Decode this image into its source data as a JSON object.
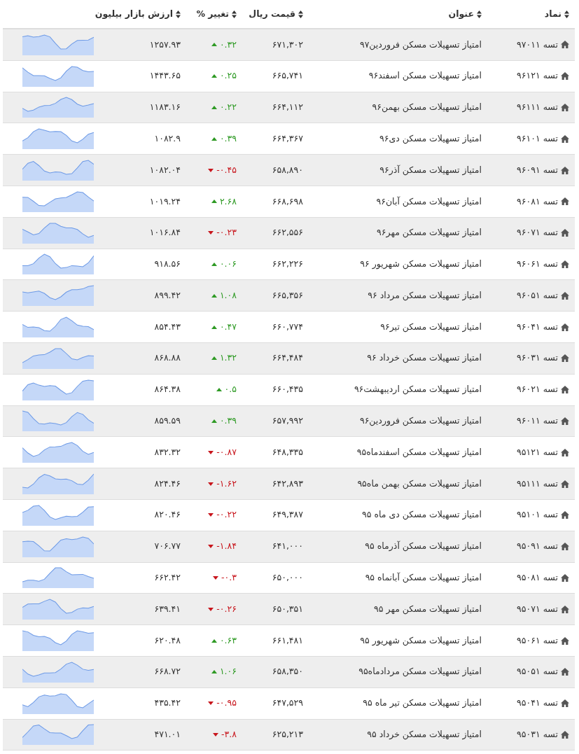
{
  "table": {
    "columns": [
      "نماد",
      "عنوان",
      "قیمت ریال",
      "تغییر %",
      "ارزش بازار بیلیون"
    ],
    "rows": [
      {
        "symbol": "تسه ۹۷۰۱۱",
        "title": "امتیاز تسهیلات مسکن فروردین۹۷",
        "price": "۶۷۱,۳۰۲",
        "change": "۰.۳۲",
        "kind": "up",
        "market_value": "۱۲۵۷.۹۳"
      },
      {
        "symbol": "تسه ۹۶۱۲۱",
        "title": "امتیاز تسهیلات مسکن اسفند۹۶",
        "price": "۶۶۵,۷۴۱",
        "change": "۰.۲۵",
        "kind": "up",
        "market_value": "۱۴۴۳.۶۵"
      },
      {
        "symbol": "تسه ۹۶۱۱۱",
        "title": "امتیاز تسهیلات مسکن بهمن۹۶",
        "price": "۶۶۴,۱۱۲",
        "change": "۰.۲۲",
        "kind": "up",
        "market_value": "۱۱۸۳.۱۶"
      },
      {
        "symbol": "تسه ۹۶۱۰۱",
        "title": "امتیاز تسهیلات مسکن دی۹۶",
        "price": "۶۶۴,۳۶۷",
        "change": "۰.۳۹",
        "kind": "up",
        "market_value": "۱۰۸۲.۹"
      },
      {
        "symbol": "تسه ۹۶۰۹۱",
        "title": "امتیاز تسهیلات مسکن آذر۹۶",
        "price": "۶۵۸,۸۹۰",
        "change": "-۰.۴۵",
        "kind": "down",
        "market_value": "۱۰۸۲.۰۴"
      },
      {
        "symbol": "تسه ۹۶۰۸۱",
        "title": "امتیاز تسهیلات مسکن آبان۹۶",
        "price": "۶۶۸,۶۹۸",
        "change": "۲.۶۸",
        "kind": "up",
        "market_value": "۱۰۱۹.۲۴"
      },
      {
        "symbol": "تسه ۹۶۰۷۱",
        "title": "امتیاز تسهیلات مسکن مهر۹۶",
        "price": "۶۶۲,۵۵۶",
        "change": "-۰.۲۳",
        "kind": "down",
        "market_value": "۱۰۱۶.۸۴"
      },
      {
        "symbol": "تسه ۹۶۰۶۱",
        "title": "امتیاز تسهیلات مسکن شهریور ۹۶",
        "price": "۶۶۲,۲۲۶",
        "change": "۰.۰۶",
        "kind": "up",
        "market_value": "۹۱۸.۵۶"
      },
      {
        "symbol": "تسه ۹۶۰۵۱",
        "title": "امتیاز تسهیلات مسکن مرداد ۹۶",
        "price": "۶۶۵,۳۵۶",
        "change": "۱.۰۸",
        "kind": "up",
        "market_value": "۸۹۹.۴۲"
      },
      {
        "symbol": "تسه ۹۶۰۴۱",
        "title": "امتیاز تسهیلات مسکن تیر۹۶",
        "price": "۶۶۰,۷۷۴",
        "change": "۰.۴۷",
        "kind": "up",
        "market_value": "۸۵۴.۴۳"
      },
      {
        "symbol": "تسه ۹۶۰۳۱",
        "title": "امتیاز تسهیلات مسکن خرداد ۹۶",
        "price": "۶۶۴,۴۸۴",
        "change": "۱.۳۲",
        "kind": "up",
        "market_value": "۸۶۸.۸۸"
      },
      {
        "symbol": "تسه ۹۶۰۲۱",
        "title": "امتیاز تسهیلات مسکن اردیبهشت۹۶",
        "price": "۶۶۰,۴۳۵",
        "change": "۰.۵",
        "kind": "up",
        "market_value": "۸۶۴.۳۸"
      },
      {
        "symbol": "تسه ۹۶۰۱۱",
        "title": "امتیاز تسهیلات مسکن فروردین۹۶",
        "price": "۶۵۷,۹۹۲",
        "change": "۰.۳۹",
        "kind": "up",
        "market_value": "۸۵۹.۵۹"
      },
      {
        "symbol": "تسه ۹۵۱۲۱",
        "title": "امتیاز تسهیلات مسکن اسفندماه۹۵",
        "price": "۶۴۸,۳۳۵",
        "change": "-۰.۸۷",
        "kind": "down",
        "market_value": "۸۳۲.۳۲"
      },
      {
        "symbol": "تسه ۹۵۱۱۱",
        "title": "امتیاز تسهیلات مسکن بهمن ماه۹۵",
        "price": "۶۴۲,۸۹۳",
        "change": "-۱.۶۲",
        "kind": "down",
        "market_value": "۸۲۴.۴۶"
      },
      {
        "symbol": "تسه ۹۵۱۰۱",
        "title": "امتیاز تسهیلات مسکن دی ماه ۹۵",
        "price": "۶۴۹,۳۸۷",
        "change": "-۰.۲۲",
        "kind": "down",
        "market_value": "۸۲۰.۴۶"
      },
      {
        "symbol": "تسه ۹۵۰۹۱",
        "title": "امتیاز تسهیلات مسکن آذرماه ۹۵",
        "price": "۶۴۱,۰۰۰",
        "change": "-۱.۸۴",
        "kind": "down",
        "market_value": "۷۰۶.۷۷"
      },
      {
        "symbol": "تسه ۹۵۰۸۱",
        "title": "امتیاز تسهیلات مسکن آبانماه ۹۵",
        "price": "۶۵۰,۰۰۰",
        "change": "-۰.۳",
        "kind": "down",
        "market_value": "۶۶۲.۴۲"
      },
      {
        "symbol": "تسه ۹۵۰۷۱",
        "title": "امتیاز تسهیلات مسکن مهر ۹۵",
        "price": "۶۵۰,۳۵۱",
        "change": "-۰.۲۶",
        "kind": "down",
        "market_value": "۶۳۹.۴۱"
      },
      {
        "symbol": "تسه ۹۵۰۶۱",
        "title": "امتیاز تسهیلات مسکن شهریور ۹۵",
        "price": "۶۶۱,۴۸۱",
        "change": "۰.۶۳",
        "kind": "up",
        "market_value": "۶۲۰.۴۸"
      },
      {
        "symbol": "تسه ۹۵۰۵۱",
        "title": "امتیاز تسهیلات مسکن مردادماه۹۵",
        "price": "۶۵۸,۳۵۰",
        "change": "۱.۰۶",
        "kind": "up",
        "market_value": "۶۶۸.۷۲"
      },
      {
        "symbol": "تسه ۹۵۰۴۱",
        "title": "امتیاز تسهیلات مسکن تیر ماه ۹۵",
        "price": "۶۴۷,۵۲۹",
        "change": "-۰.۹۵",
        "kind": "down",
        "market_value": "۴۳۵.۴۲"
      },
      {
        "symbol": "تسه ۹۵۰۳۱",
        "title": "امتیاز تسهیلات مسکن خرداد ۹۵",
        "price": "۶۲۵,۲۱۳",
        "change": "-۳.۸",
        "kind": "down",
        "market_value": "۴۷۱.۰۱"
      }
    ]
  }
}
